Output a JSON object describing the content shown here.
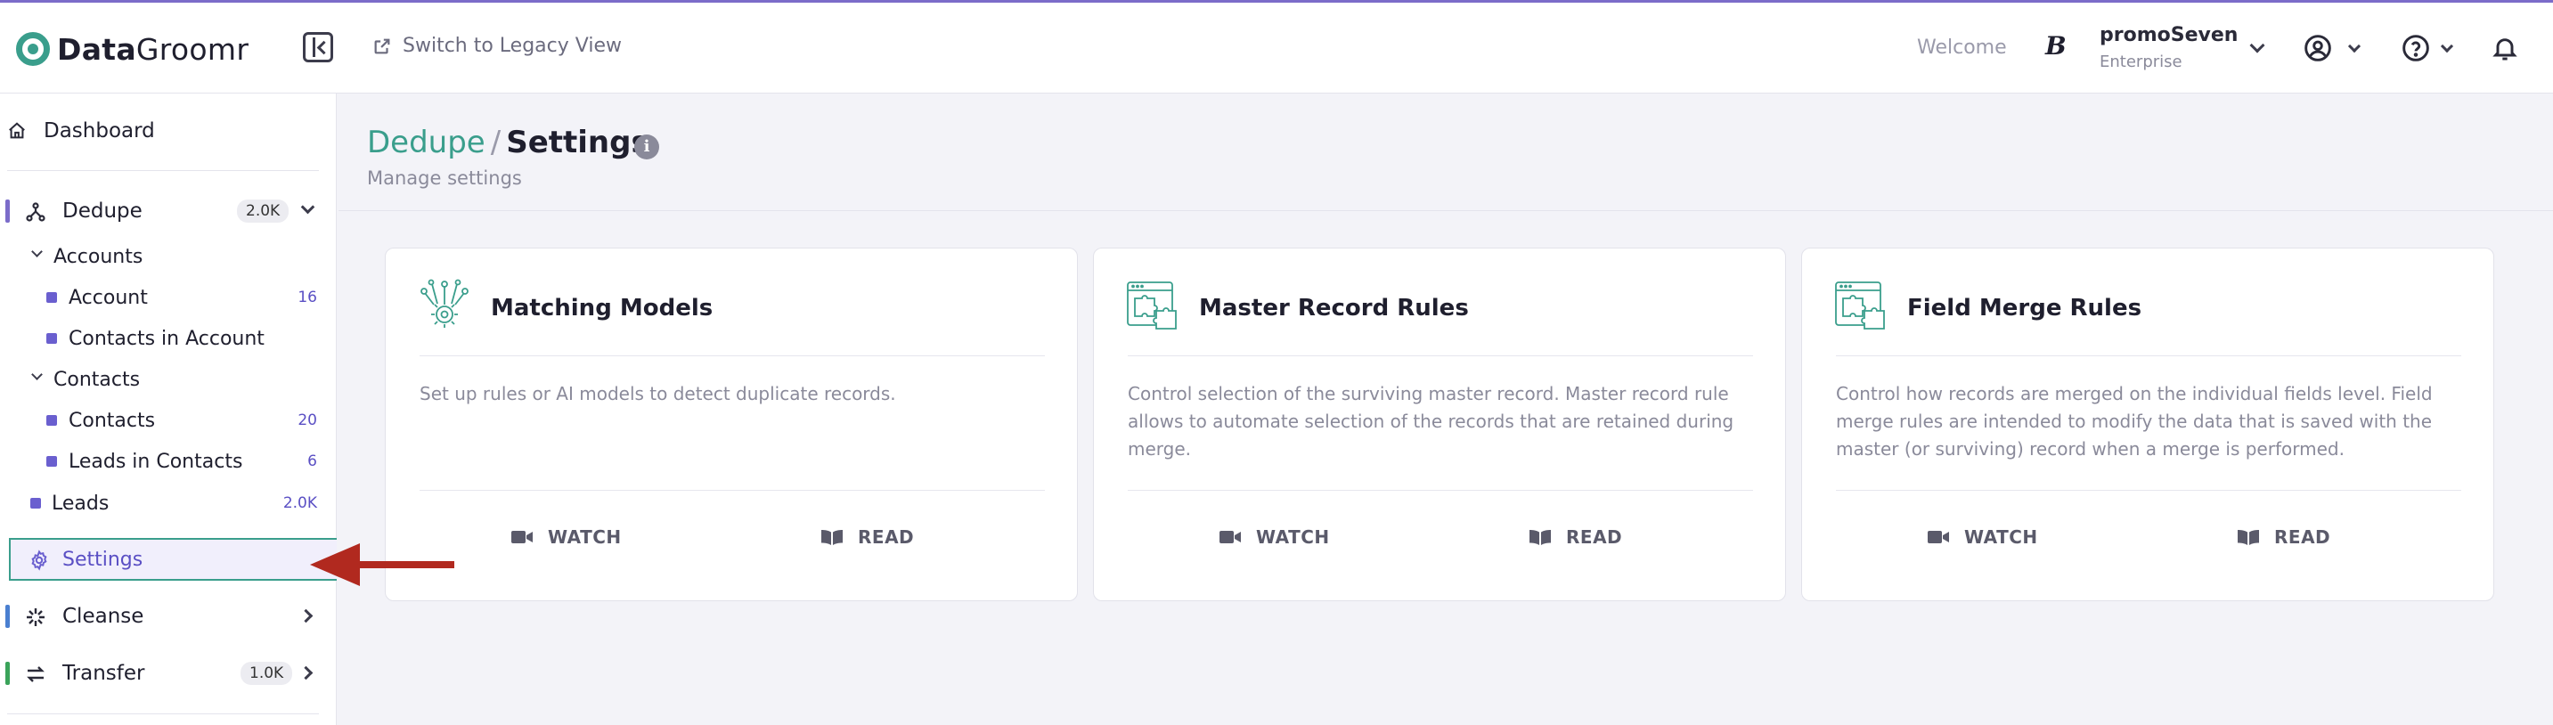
{
  "header": {
    "logo_bold": "Data",
    "logo_regular": "Groomr",
    "legacy_link": "Switch to Legacy View",
    "welcome": "Welcome",
    "user_logo": "B",
    "user_name": "promoSeven",
    "user_plan": "Enterprise"
  },
  "sidebar": {
    "dashboard": "Dashboard",
    "dedupe": {
      "label": "Dedupe",
      "badge": "2.0K"
    },
    "accounts_group": "Accounts",
    "account": {
      "label": "Account",
      "count": "16"
    },
    "contacts_in_account": {
      "label": "Contacts in Account"
    },
    "contacts_group": "Contacts",
    "contacts": {
      "label": "Contacts",
      "count": "20"
    },
    "leads_in_contacts": {
      "label": "Leads in Contacts",
      "count": "6"
    },
    "leads": {
      "label": "Leads",
      "count": "2.0K"
    },
    "settings": "Settings",
    "cleanse": {
      "label": "Cleanse"
    },
    "transfer": {
      "label": "Transfer",
      "badge": "1.0K"
    }
  },
  "page": {
    "crumb_parent": "Dedupe",
    "crumb_sep": "/",
    "crumb_current": "Settings",
    "info_glyph": "i",
    "subtitle": "Manage settings"
  },
  "cards": [
    {
      "title": "Matching Models",
      "description": "Set up rules or AI models to detect duplicate records.",
      "watch": "WATCH",
      "read": "READ",
      "icon": "ai-network-gear-icon"
    },
    {
      "title": "Master Record Rules",
      "description": "Control selection of the surviving master record. Master record rule allows to automate selection of the records that are retained during merge.",
      "watch": "WATCH",
      "read": "READ",
      "icon": "puzzle-window-icon"
    },
    {
      "title": "Field Merge Rules",
      "description": "Control how records are merged on the individual fields level. Field merge rules are intended to modify the data that is saved with the master (or surviving) record when a merge is performed.",
      "watch": "WATCH",
      "read": "READ",
      "icon": "puzzle-window-icon"
    }
  ],
  "colors": {
    "brand": "#3a9e8c",
    "accent": "#6a5fcf",
    "dedupe_bar": "#7b6cc9",
    "cleanse_bar": "#4a7fd0",
    "transfer_bar": "#3aa35a",
    "arrow": "#b1291f"
  }
}
